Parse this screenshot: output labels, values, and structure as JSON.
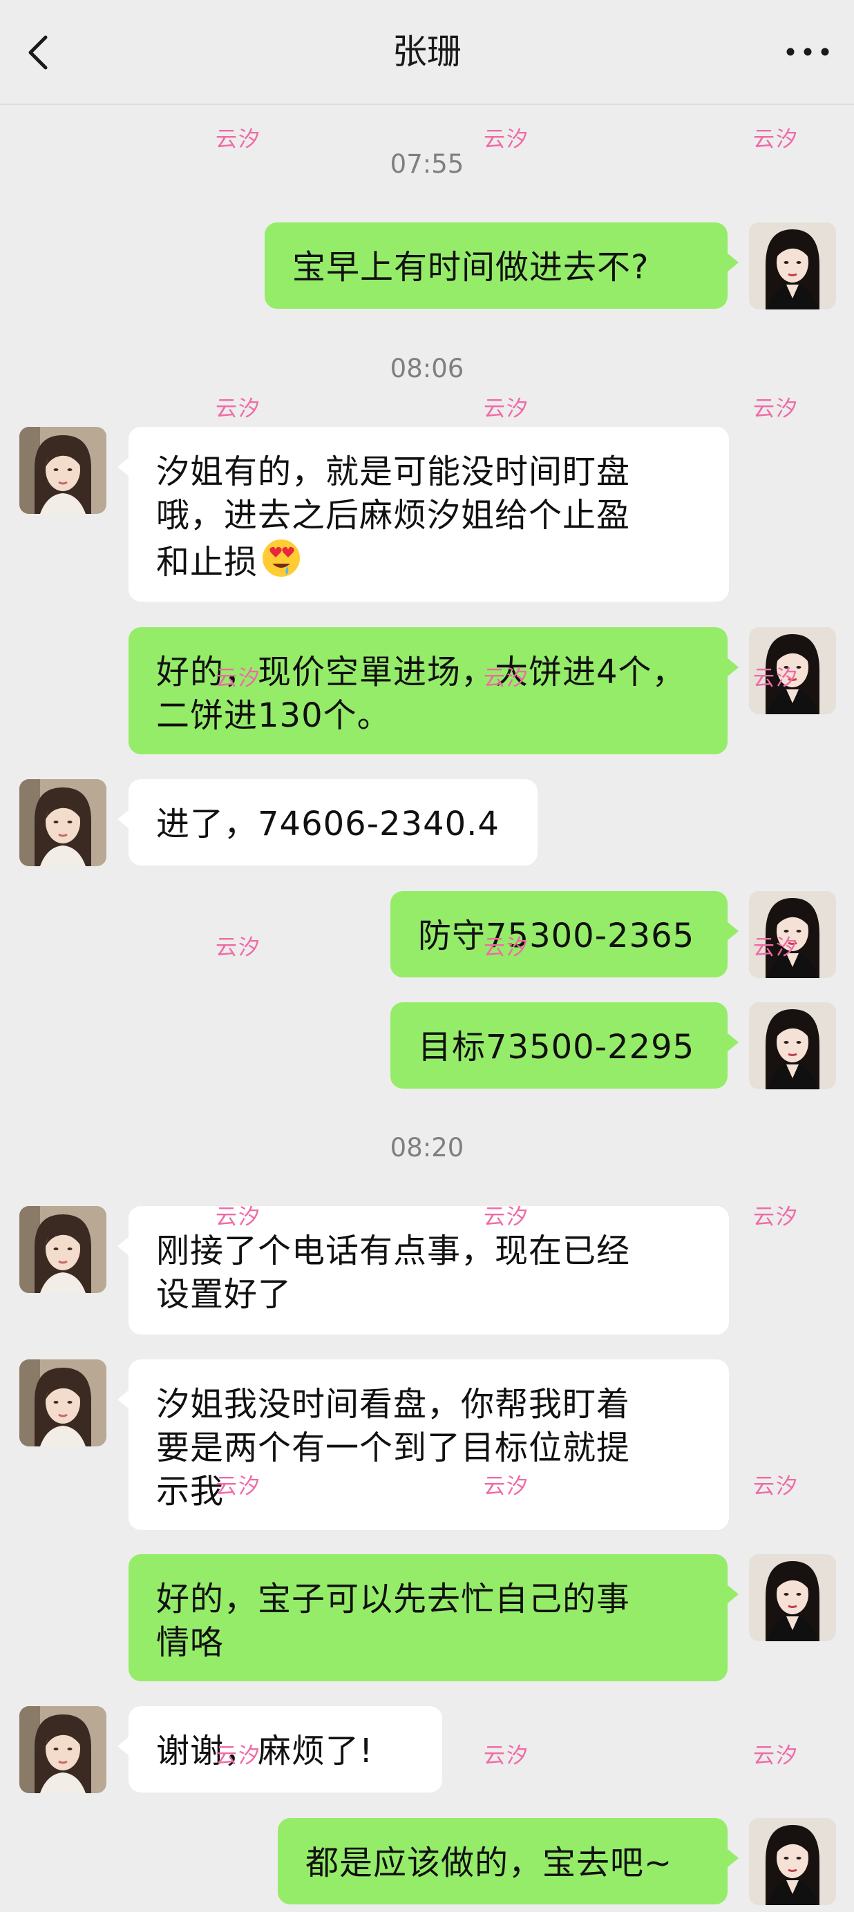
{
  "header": {
    "title": "张珊",
    "back_icon": "chevron-left-icon",
    "more_icon": "ellipsis-icon"
  },
  "colors": {
    "background": "#ededed",
    "sent_bubble": "#95ec69",
    "received_bubble": "#ffffff",
    "watermark": "#f06aa6"
  },
  "watermark": "云汐",
  "timestamps": [
    "07:55",
    "08:06",
    "08:20"
  ],
  "messages": [
    {
      "side": "right",
      "text": "宝早上有时间做进去不?"
    },
    {
      "side": "left",
      "lines": [
        "汐姐有的，就是可能没时间盯盘",
        "哦，进去之后麻烦汐姐给个止盈",
        "和止损"
      ],
      "emoji": "heart-eyes-drooling-emoji"
    },
    {
      "side": "right",
      "lines": [
        "好的，现价空單进场，大饼进4个，",
        "二饼进130个。"
      ]
    },
    {
      "side": "left",
      "text": "进了，74606-2340.4"
    },
    {
      "side": "right",
      "text": "防守75300-2365"
    },
    {
      "side": "right",
      "text": "目标73500-2295"
    },
    {
      "side": "left",
      "lines": [
        "刚接了个电话有点事，现在已经",
        "设置好了"
      ]
    },
    {
      "side": "left",
      "lines": [
        "汐姐我没时间看盘，你帮我盯着",
        "要是两个有一个到了目标位就提",
        "示我"
      ]
    },
    {
      "side": "right",
      "lines": [
        "好的，宝子可以先去忙自己的事",
        "情咯"
      ]
    },
    {
      "side": "left",
      "text": "谢谢，麻烦了!"
    },
    {
      "side": "right",
      "text": "都是应该做的，宝去吧~"
    }
  ]
}
